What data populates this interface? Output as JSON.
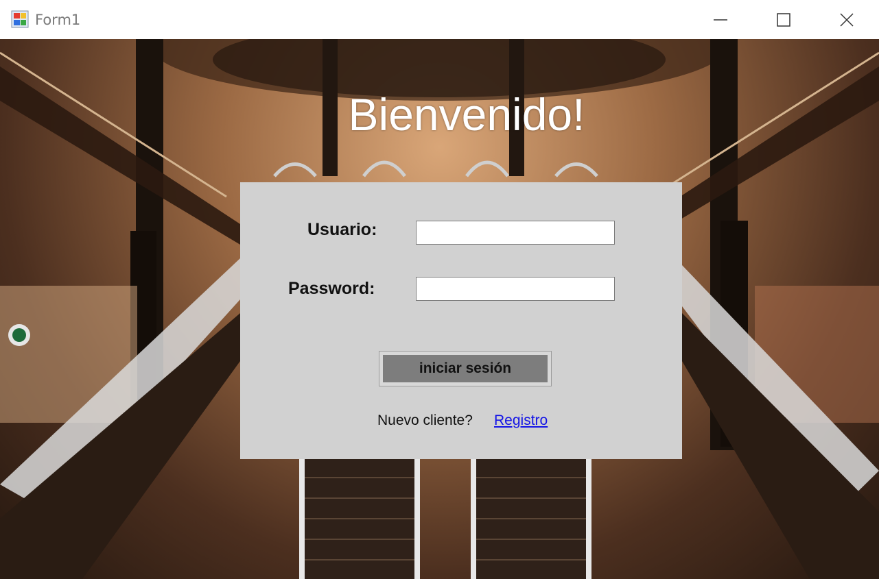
{
  "window": {
    "title": "Form1",
    "minimize_icon": "minimize-icon",
    "maximize_icon": "maximize-icon",
    "close_icon": "close-icon"
  },
  "login": {
    "welcome": "Bienvenido!",
    "user_label": "Usuario:",
    "user_value": "",
    "password_label": "Password:",
    "password_value": "",
    "submit_label": "iniciar sesión",
    "new_client_text": "Nuevo cliente?",
    "register_link": "Registro"
  },
  "colors": {
    "panel": "#d1d1d1",
    "button": "#7d7d7d",
    "link": "#1414e6",
    "welcome_text": "#ffffff"
  }
}
